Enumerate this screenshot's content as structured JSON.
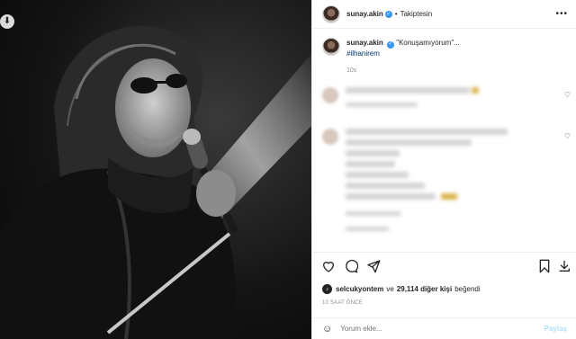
{
  "post": {
    "username": "sunay.akin",
    "verified_symbol": "✓",
    "separator": "•",
    "follow_status": "Takiptesin",
    "more_symbol": "•••",
    "caption_text": "\"Konuşamıyorum\"...",
    "hashtag": "#ilhanirem",
    "caption_time": "10s"
  },
  "photo": {
    "download_symbol": "⬇"
  },
  "likes": {
    "first_liker": "selcukyontem",
    "connector": "ve",
    "count_text": "29,114 diğer kişi",
    "suffix": "beğendi",
    "liker_initial": "♪"
  },
  "timestamp": "10 SAAT ÖNCE",
  "comment_box": {
    "smile_symbol": "☺",
    "placeholder": "Yorum ekle...",
    "post_label": "Paylaş"
  },
  "icons": {
    "like": "heart-icon",
    "comment": "comment-icon",
    "share": "send-icon",
    "save": "bookmark-icon",
    "download": "download-icon"
  },
  "colors": {
    "verified": "#3897f0",
    "hashtag": "#00376b",
    "post_button_disabled": "#b2dffc",
    "muted": "#8e8e8e"
  }
}
